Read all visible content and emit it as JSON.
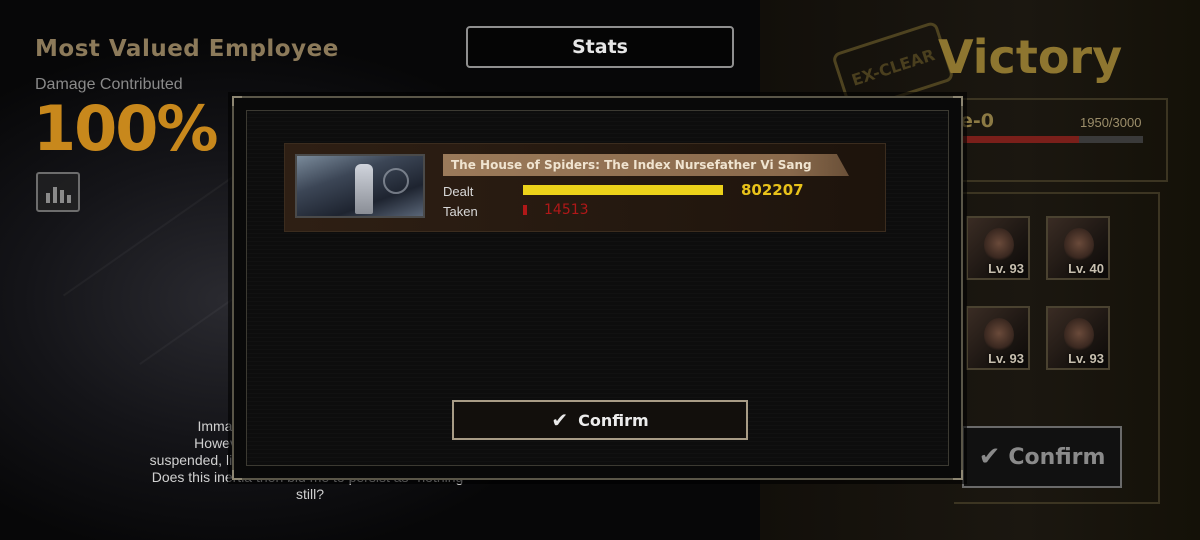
{
  "left_panel": {
    "title": "Most Valued Employee",
    "subtitle": "Damage Contributed",
    "percent": "100%"
  },
  "flavor_text": {
    "lines": [
      "Immaculate in its",
      "However... \"...\"",
      "suspended, lingering beyond any promise of arrival.",
      "Does this inertia then bid me to persist as \"nothing\"",
      "still?"
    ]
  },
  "stats_tab": {
    "label": "Stats"
  },
  "right_panel": {
    "result": "Victory",
    "stamp": "EX-CLEAR",
    "level": "e-0",
    "exp": "1950/3000",
    "exp_fraction": 0.65,
    "roster": [
      {
        "level": "Lv. 93"
      },
      {
        "level": "Lv. 40"
      },
      {
        "level": "Lv. 93"
      },
      {
        "level": "Lv. 93"
      }
    ],
    "confirm_label": "Confirm"
  },
  "modal": {
    "boss_name": "The House of Spiders: The Index Nursefather Vi Sang",
    "dealt_label": "Dealt",
    "taken_label": "Taken",
    "dealt_value": "802207",
    "taken_value": "14513",
    "dealt_fraction": 1.0,
    "taken_fraction": 0.018,
    "confirm_label": "Confirm"
  },
  "colors": {
    "accent_gold": "#c8881c",
    "dealt_bar": "#ecd21a",
    "taken_bar": "#b01818"
  }
}
